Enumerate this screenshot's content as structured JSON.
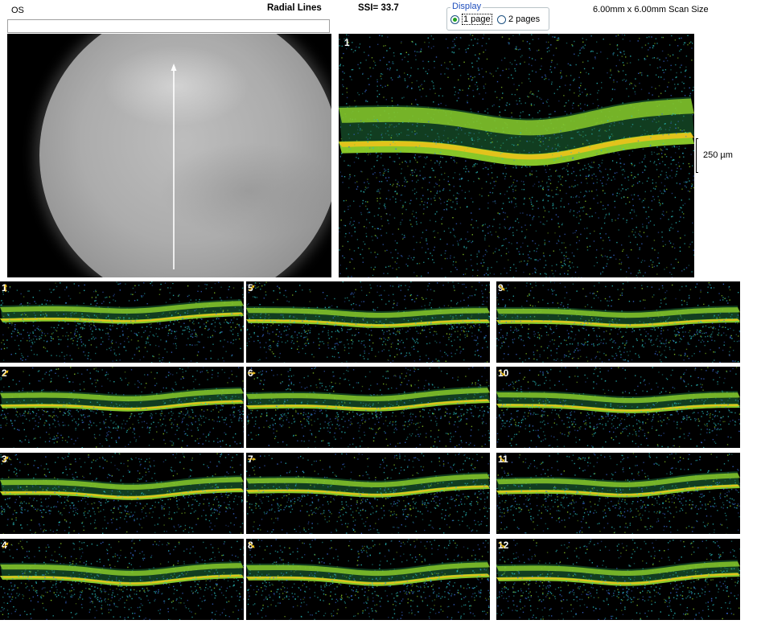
{
  "header": {
    "eye": "OS",
    "protocol": "Radial Lines",
    "ssi": "SSI= 33.7",
    "scan_size": "6.00mm x 6.00mm Scan Size"
  },
  "display": {
    "legend": "Display",
    "options": [
      {
        "label": "1 page",
        "selected": true
      },
      {
        "label": "2 pages",
        "selected": false
      }
    ]
  },
  "main_scan": {
    "number": "1"
  },
  "scale_bar": {
    "label": "250 µm"
  },
  "thumbnails": [
    {
      "number": "1",
      "arrow": "up-arrow-icon"
    },
    {
      "number": "2",
      "arrow": "up-right-arrow-icon"
    },
    {
      "number": "3",
      "arrow": "up-right-arrow-icon"
    },
    {
      "number": "4",
      "arrow": "up-right-arrow-icon"
    },
    {
      "number": "5",
      "arrow": "up-right-arrow-icon"
    },
    {
      "number": "6",
      "arrow": "right-arrow-icon"
    },
    {
      "number": "7",
      "arrow": "right-arrow-icon"
    },
    {
      "number": "8",
      "arrow": "down-right-arrow-icon"
    },
    {
      "number": "9",
      "arrow": "down-right-arrow-icon"
    },
    {
      "number": "10",
      "arrow": "down-right-arrow-icon"
    },
    {
      "number": "11",
      "arrow": "down-right-arrow-icon"
    },
    {
      "number": "12",
      "arrow": "down-right-arrow-icon"
    }
  ],
  "colors": {
    "retina_green": "#8fd12a",
    "rpe_yellow": "#f2c21a",
    "speckle_cyan": "#2bbfbf",
    "legend_blue": "#1f4fbd",
    "radio_green": "#21a121"
  }
}
